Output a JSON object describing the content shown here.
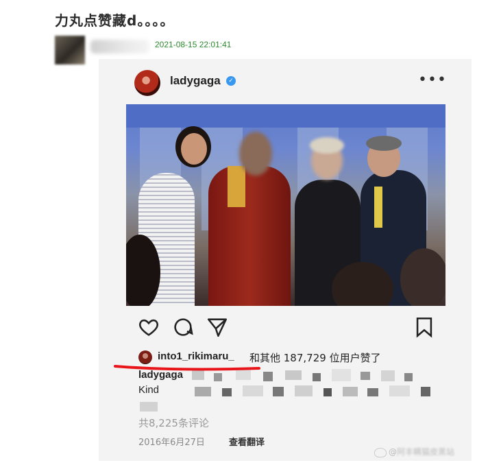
{
  "post": {
    "title": "力丸点赞藏d。。。。",
    "timestamp": "2021-08-15 22:01:41"
  },
  "instagram": {
    "username": "ladygaga",
    "verified_icon": "verified-badge-icon",
    "more_icon": "more-dots-icon",
    "actions": [
      "heart-icon",
      "comment-icon",
      "share-icon",
      "bookmark-icon"
    ],
    "likes": {
      "liker": "into1_rikimaru_",
      "text": "和其他 187,729 位用户赞了"
    },
    "caption_user": "ladygaga",
    "caption_start": "Kind",
    "comments": "共8,225条评论",
    "date": "2016年6月27日",
    "see_translation": "查看翻译"
  },
  "watermark": {
    "prefix": "@",
    "text": "阿丰瞒猫皮黑站"
  },
  "colors": {
    "timestamp": "#2d8a2d",
    "verified": "#3897f0",
    "highlight_underline": "#e8151b"
  }
}
